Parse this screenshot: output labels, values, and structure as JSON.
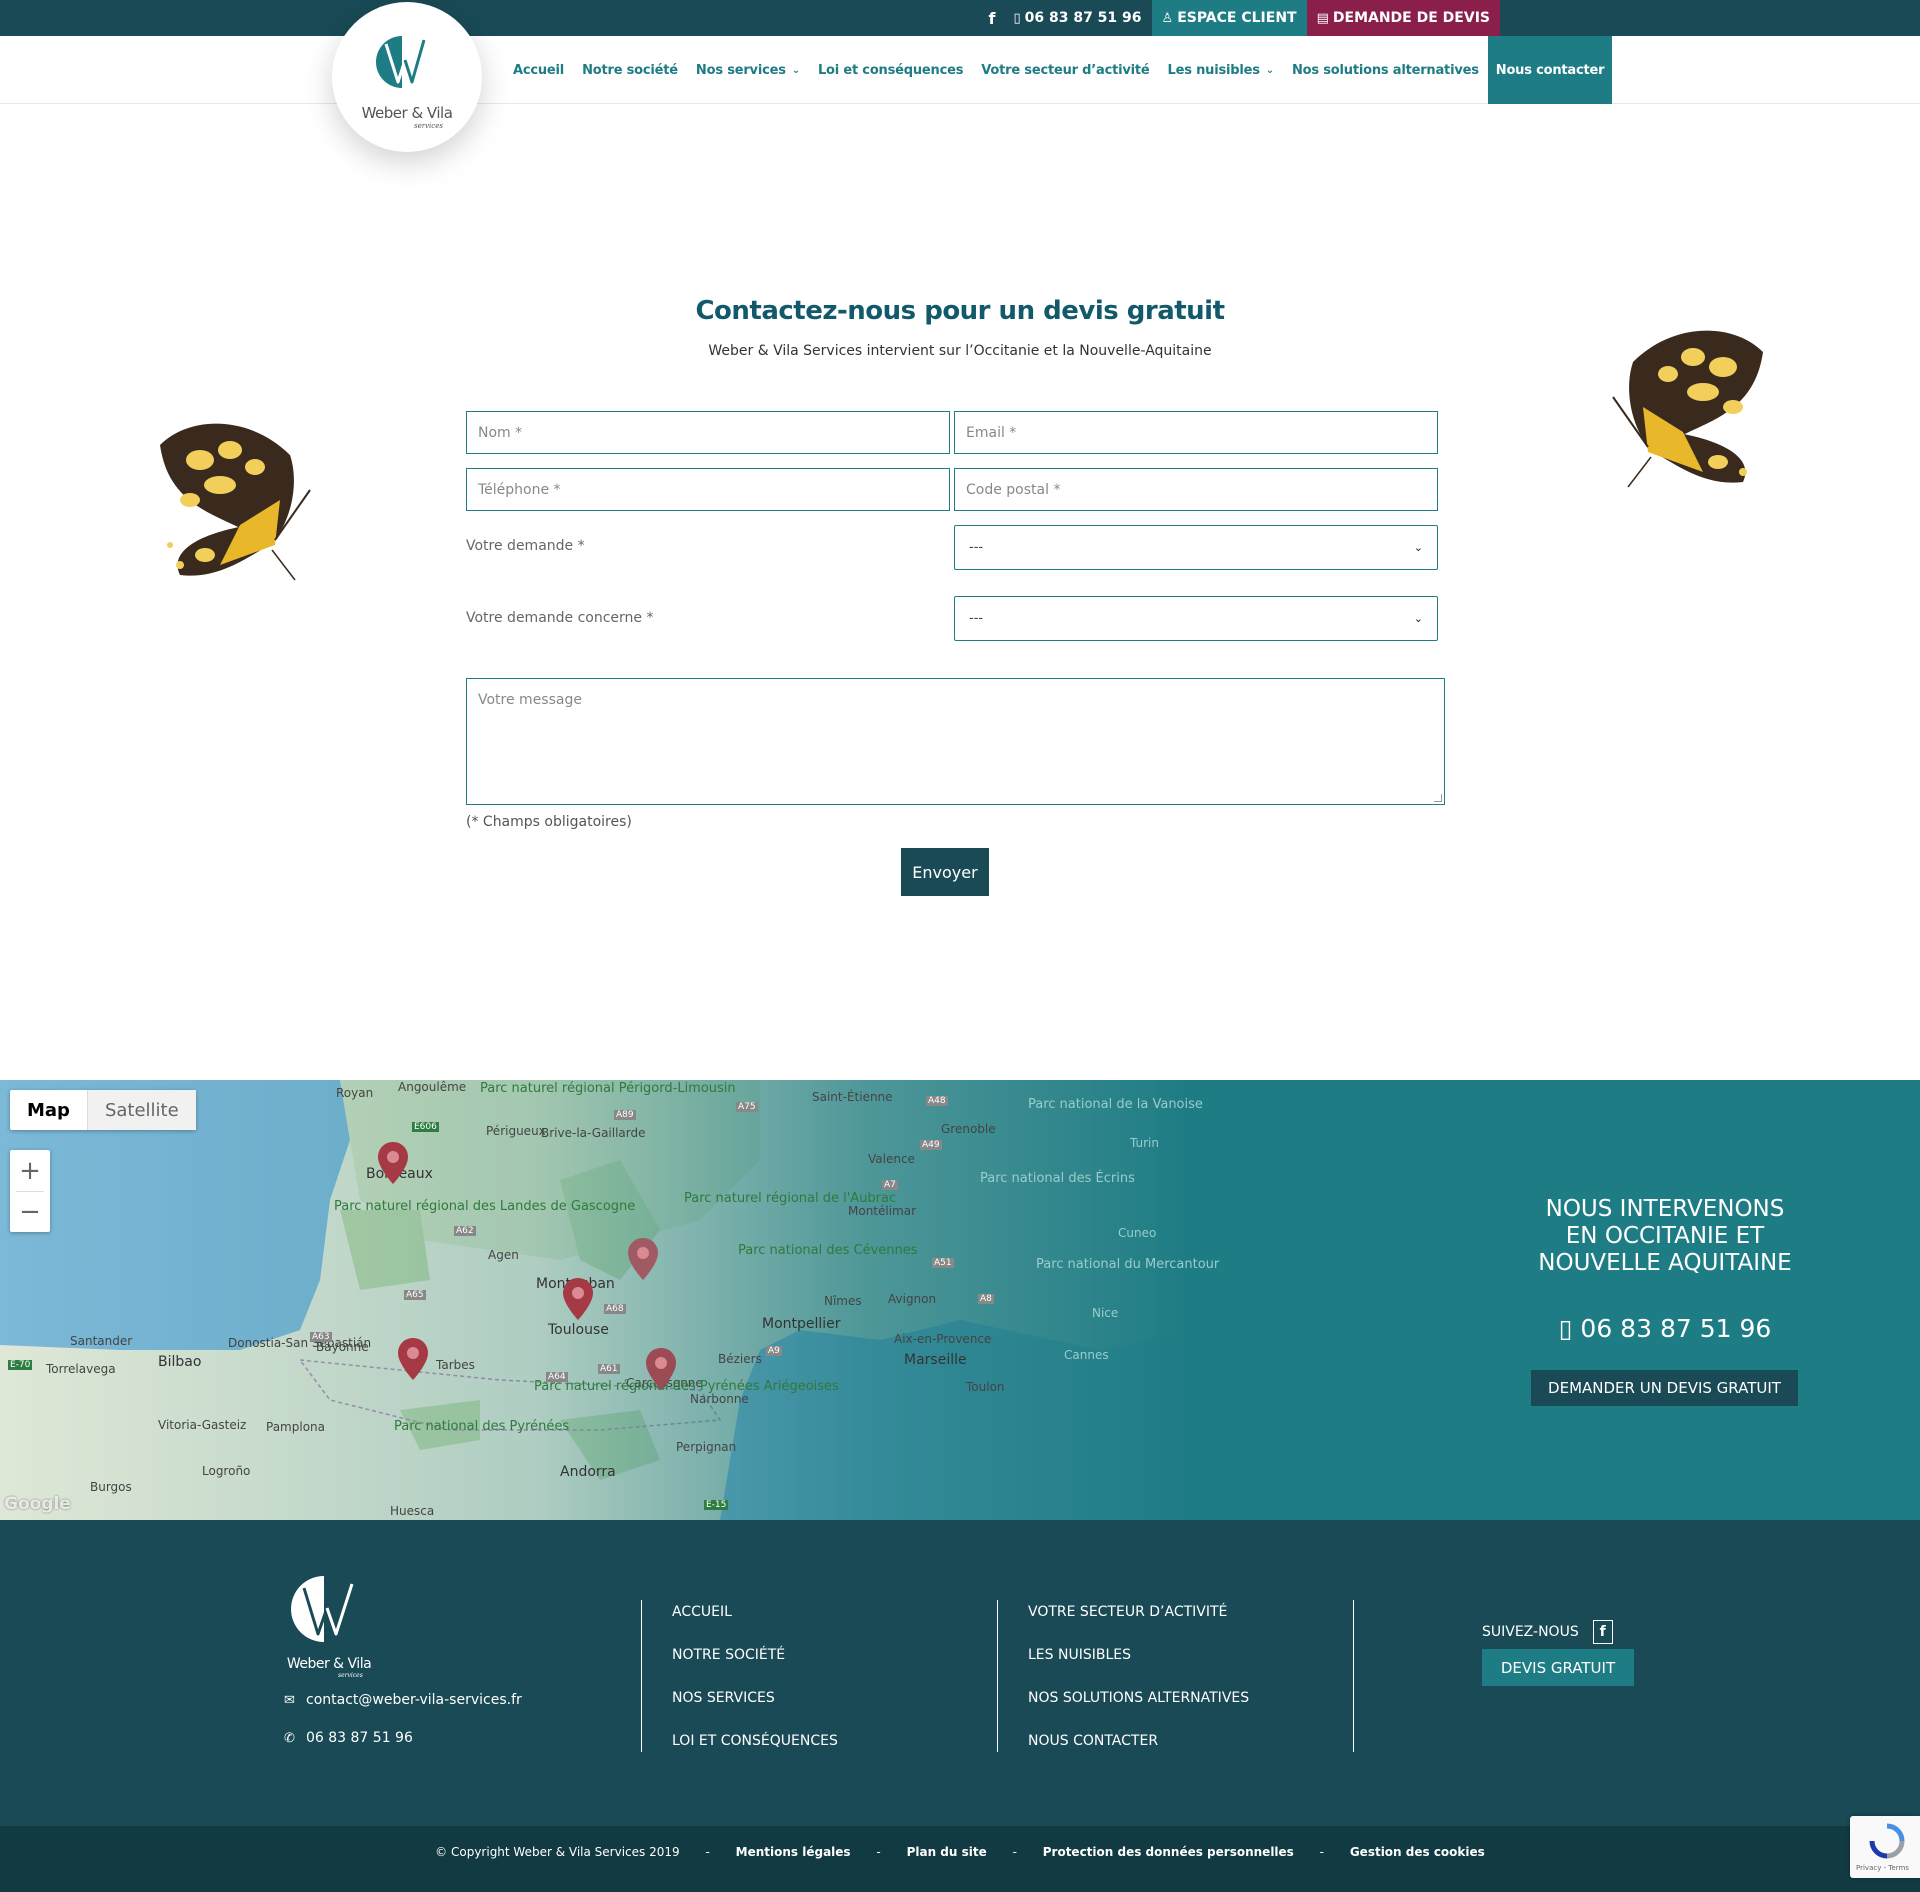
{
  "topbar": {
    "facebook_icon": "facebook-icon",
    "phone": "06 83 87 51 96",
    "espace_client": "ESPACE CLIENT",
    "demande_devis": "DEMANDE DE DEVIS"
  },
  "logo": {
    "name": "Weber & Vila",
    "sub": "services"
  },
  "nav": {
    "items": [
      {
        "label": "Accueil",
        "has_submenu": false
      },
      {
        "label": "Notre société",
        "has_submenu": false
      },
      {
        "label": "Nos services",
        "has_submenu": true
      },
      {
        "label": "Loi et conséquences",
        "has_submenu": false
      },
      {
        "label": "Votre secteur d’activité",
        "has_submenu": false
      },
      {
        "label": "Les nuisibles",
        "has_submenu": true
      },
      {
        "label": "Nos solutions alternatives",
        "has_submenu": false
      },
      {
        "label": "Nous contacter",
        "has_submenu": false,
        "active": true
      }
    ]
  },
  "contact": {
    "title": "Contactez-nous pour un devis gratuit",
    "subtitle": "Weber & Vila Services intervient sur l’Occitanie et la Nouvelle-Aquitaine",
    "nom_placeholder": "Nom *",
    "email_placeholder": "Email *",
    "telephone_placeholder": "Téléphone *",
    "code_postal_placeholder": "Code postal *",
    "demande_label": "Votre demande *",
    "demande_value": "---",
    "concerne_label": "Votre demande concerne *",
    "concerne_value": "---",
    "message_placeholder": "Votre message",
    "required_note": "(* Champs obligatoires)",
    "send_label": "Envoyer"
  },
  "map": {
    "type_map": "Map",
    "type_satellite": "Satellite",
    "zoom_in": "+",
    "zoom_out": "−",
    "attribution": "Google",
    "labels": {
      "angouleme": "Angoulême",
      "royan": "Royan",
      "perigord": "Parc naturel régional Périgord-Limousin",
      "perigueux": "Périgueux",
      "brive": "Brive-la-Gaillarde",
      "saint_etienne": "Saint-Étienne",
      "grenoble": "Grenoble",
      "vanoise": "Parc national de la Vanoise",
      "turin": "Turin",
      "valence": "Valence",
      "ecrins": "Parc national des Écrins",
      "bordeaux": "Bordeaux",
      "landes": "Parc naturel régional des Landes de Gascogne",
      "aubrac": "Parc naturel régional de l'Aubrac",
      "montelimar": "Montélimar",
      "cuneo": "Cuneo",
      "agen": "Agen",
      "montauban": "Montauban",
      "cevennes": "Parc national des Cévennes",
      "mercantour": "Parc national du Mercantour",
      "avignon": "Avignon",
      "nimes": "Nîmes",
      "toulouse": "Toulouse",
      "montpellier": "Montpellier",
      "nice": "Nice",
      "aix": "Aix-en-Provence",
      "cannes": "Cannes",
      "santander": "Santander",
      "donostia": "Donostia-San Sebastián",
      "bayonne": "Bayonne",
      "beziers": "Béziers",
      "marseille": "Marseille",
      "torrelavega": "Torrelavega",
      "bilbao": "Bilbao",
      "tarbes": "Tarbes",
      "carcassonne": "Carcassonne",
      "toulon": "Toulon",
      "ariegeoises": "Parc naturel régional des Pyrénées Ariégeoises",
      "narbonne": "Narbonne",
      "vitoria": "Vitoria-Gasteiz",
      "pamplona": "Pamplona",
      "pyrenees": "Parc national des Pyrénées",
      "perpignan": "Perpignan",
      "logrono": "Logroño",
      "andorra": "Andorra",
      "burgos": "Burgos",
      "huesca": "Huesca",
      "e70": "E-70",
      "a63": "A63",
      "e606": "E606",
      "a89": "A89",
      "a75": "A75",
      "a62": "A62",
      "a65": "A65",
      "a68": "A68",
      "a64": "A64",
      "a61": "A61",
      "a9": "A9",
      "e15": "E-15",
      "a7": "A7",
      "a49": "A49",
      "a48": "A48",
      "a8": "A8",
      "a51": "A51"
    },
    "marker_icon": "map-pin-icon",
    "marker_count": 5
  },
  "region": {
    "title_line1": "NOUS INTERVENONS",
    "title_line2": "EN OCCITANIE ET",
    "title_line3": "NOUVELLE AQUITAINE",
    "phone_icon": "mobile-phone-icon",
    "phone": "06 83 87 51 96",
    "button": "DEMANDER UN DEVIS GRATUIT"
  },
  "footer": {
    "logo_name": "Weber & Vila",
    "logo_sub": "services",
    "email": "contact@weber-vila-services.fr",
    "phone": "06 83 87 51 96",
    "col1": [
      "ACCUEIL",
      "NOTRE SOCIÉTÉ",
      "NOS SERVICES",
      "LOI ET CONSÉQUENCES"
    ],
    "col2": [
      "VOTRE SECTEUR D’ACTIVITÉ",
      "LES NUISIBLES",
      "NOS SOLUTIONS ALTERNATIVES",
      "NOUS CONTACTER"
    ],
    "follow": "SUIVEZ-NOUS",
    "fb": "f",
    "devis": "DEVIS GRATUIT"
  },
  "bottom": {
    "copyright": "© Copyright Weber & Vila Services 2019",
    "sep": "-",
    "mentions": "Mentions légales",
    "plan": "Plan du site",
    "protection": "Protection des données personnelles",
    "cookies": "Gestion des cookies"
  },
  "recaptcha": {
    "text": "Privacy - Terms"
  },
  "colors": {
    "teal": "#1e7c84",
    "dark_teal": "#194a55",
    "darker_teal": "#123a43",
    "burgundy": "#8b1f4b",
    "title_teal": "#125a6b",
    "marker_red": "#a63a44"
  }
}
